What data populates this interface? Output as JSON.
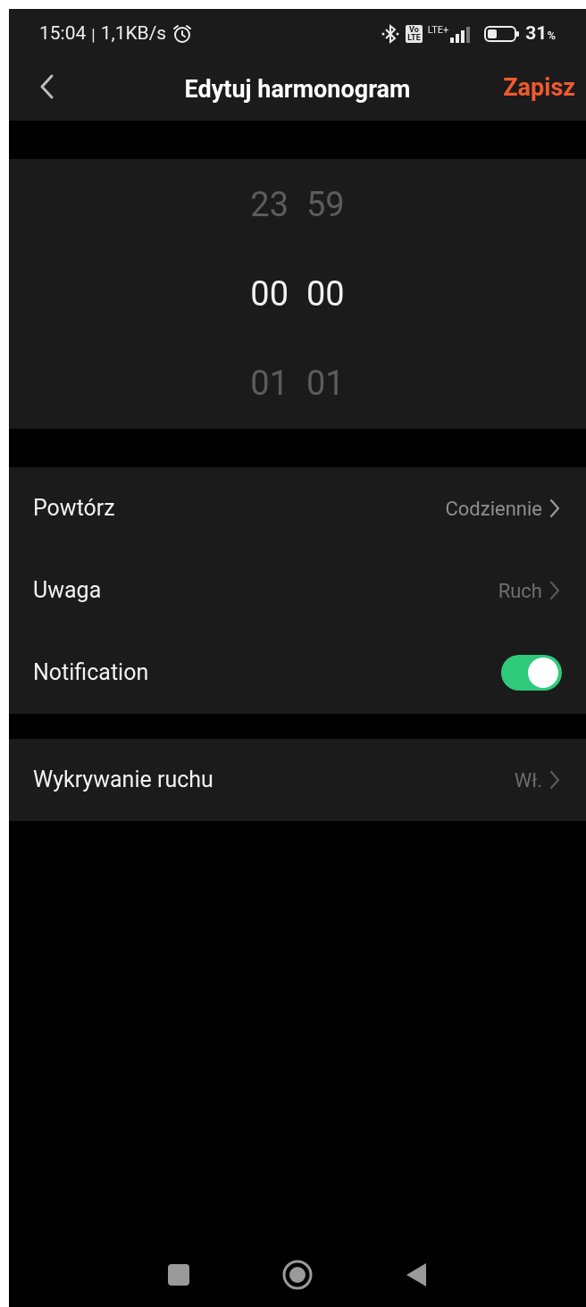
{
  "status_bar": {
    "time": "15:04",
    "separator": "|",
    "speed": "1,1KB/s",
    "volte": [
      "Vo",
      "LTE"
    ],
    "network": "LTE+",
    "battery": "31",
    "battery_unit": "%"
  },
  "header": {
    "title": "Edytuj harmonogram",
    "action": "Zapisz"
  },
  "time_picker": {
    "rows": [
      {
        "hour": "23",
        "minute": "59",
        "selected": false
      },
      {
        "hour": "00",
        "minute": "00",
        "selected": true
      },
      {
        "hour": "01",
        "minute": "01",
        "selected": false
      }
    ]
  },
  "sections": [
    {
      "items": [
        {
          "kind": "link",
          "label": "Powtórz",
          "value": "Codziennie",
          "disabled": false
        },
        {
          "kind": "link",
          "label": "Uwaga",
          "value": "Ruch",
          "disabled": true
        },
        {
          "kind": "toggle",
          "label": "Notification",
          "on": true
        }
      ]
    },
    {
      "items": [
        {
          "kind": "link",
          "label": "Wykrywanie ruchu",
          "value": "Wł.",
          "disabled": true
        }
      ]
    }
  ]
}
